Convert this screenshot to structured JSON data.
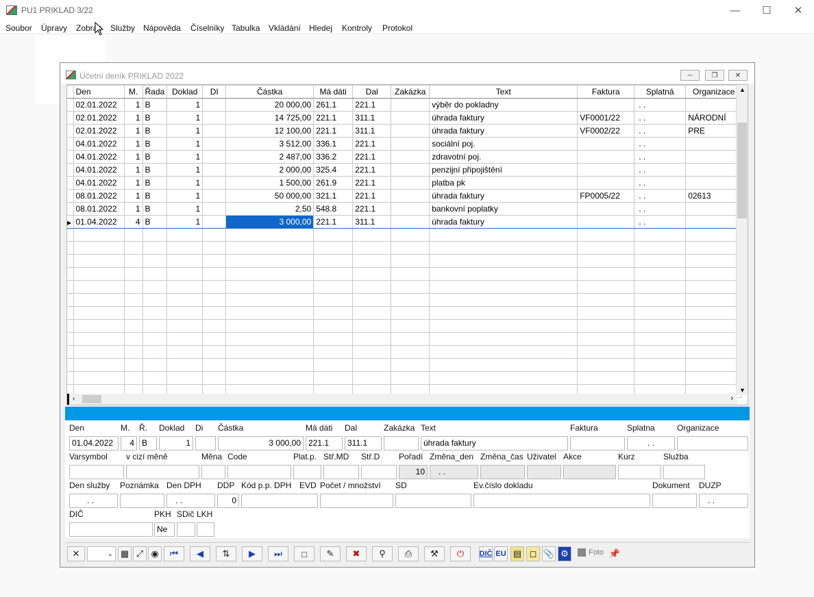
{
  "app": {
    "title": "PU1 PRIKLAD 3/22"
  },
  "menu": [
    "Soubor",
    "Úpravy",
    "Zobraz",
    "Služby",
    "Nápověda",
    "Číselníky",
    "Tabulka",
    "Vkládání",
    "Hledej",
    "Kontroly",
    "Protokol"
  ],
  "child": {
    "title": "Účetní deník  PRIKLAD   2022"
  },
  "grid": {
    "columns": [
      "Den",
      "M.",
      "Řada",
      "Doklad",
      "DI",
      "Částka",
      "Má dáti",
      "Dal",
      "Zakázka",
      "Text",
      "Faktura",
      "Splatná",
      "Organizace"
    ],
    "rows": [
      [
        "02.01.2022",
        "1",
        "B",
        "1",
        "",
        "20 000,00",
        "261.1",
        "221.1",
        "",
        "výběr do pokladny",
        "",
        ". .",
        ""
      ],
      [
        "02.01.2022",
        "1",
        "B",
        "1",
        "",
        "14 725,00",
        "221.1",
        "311.1",
        "",
        "úhrada faktury",
        "VF0001/22",
        ". .",
        "NÁRODNÍ"
      ],
      [
        "02.01.2022",
        "1",
        "B",
        "1",
        "",
        "12 100,00",
        "221.1",
        "311.1",
        "",
        "úhrada faktury",
        "VF0002/22",
        ". .",
        "PRE"
      ],
      [
        "04.01.2022",
        "1",
        "B",
        "1",
        "",
        "3 512,00",
        "336.1",
        "221.1",
        "",
        "sociální poj.",
        "",
        ". .",
        ""
      ],
      [
        "04.01.2022",
        "1",
        "B",
        "1",
        "",
        "2 487,00",
        "336.2",
        "221.1",
        "",
        "zdravotní poj.",
        "",
        ". .",
        ""
      ],
      [
        "04.01.2022",
        "1",
        "B",
        "1",
        "",
        "2 000,00",
        "325.4",
        "221.1",
        "",
        "penzijní připojištění",
        "",
        ". .",
        ""
      ],
      [
        "04.01.2022",
        "1",
        "B",
        "1",
        "",
        "1 500,00",
        "261.9",
        "221.1",
        "",
        "platba pk",
        "",
        ". .",
        ""
      ],
      [
        "08.01.2022",
        "1",
        "B",
        "1",
        "",
        "50 000,00",
        "321.1",
        "221.1",
        "",
        "úhrada faktury",
        "FP0005/22",
        ". .",
        "02613"
      ],
      [
        "08.01.2022",
        "1",
        "B",
        "1",
        "",
        "2,50",
        "548.8",
        "221.1",
        "",
        "bankovní poplatky",
        "",
        ". .",
        ""
      ],
      [
        "01.04.2022",
        "4",
        "B",
        "1",
        "",
        "3 000,00",
        "221.1",
        "311.1",
        "",
        "úhrada faktury",
        "",
        ". .",
        ""
      ]
    ],
    "selected_row": 9,
    "empty_rows": 13
  },
  "form": {
    "labels1": [
      "Den",
      "M.",
      "Ř.",
      "Doklad",
      "Di",
      "Částka",
      "Má dáti",
      "Dal",
      "Zakázka",
      "Text",
      "Faktura",
      "Splatna",
      "Organizace"
    ],
    "values1": {
      "den": "01.04.2022",
      "m": "4",
      "r": "B",
      "doklad": "1",
      "castka": "3 000,00",
      "madati": "221.1",
      "dal": "311.1",
      "text": "úhrada faktury",
      "splatna": ". ."
    },
    "labels2": [
      "Varsymbol",
      "v cizí měně",
      "Měna",
      "Code",
      "Plat.p.",
      "Stř.MD",
      "Stř.D",
      "Pořadí",
      "Změna_den",
      "Změna_čas",
      "Uživatel",
      "Akce",
      "Kurz",
      "Služba"
    ],
    "values2": {
      "poradi": "10",
      "zmena_den": ". ."
    },
    "labels3": [
      "Den služby",
      "Poznámka",
      "Den DPH",
      "DDP",
      "Kód p.p. DPH",
      "EVD",
      "Počet / množství",
      "SD",
      "Ev.číslo dokladu",
      "Dokument",
      "DUZP"
    ],
    "values3": {
      "den_sluzby": ". .",
      "den_dph": ". .",
      "ddp": "0",
      "duzp": ". ."
    },
    "labels4": [
      "DIČ",
      "PKH",
      "SDič",
      "LKH"
    ],
    "values4": {
      "pkh": "Ne"
    }
  },
  "toolbar": {
    "foto_label": "Foto",
    "dic_label": "DIČ",
    "eu_label": "EU"
  }
}
